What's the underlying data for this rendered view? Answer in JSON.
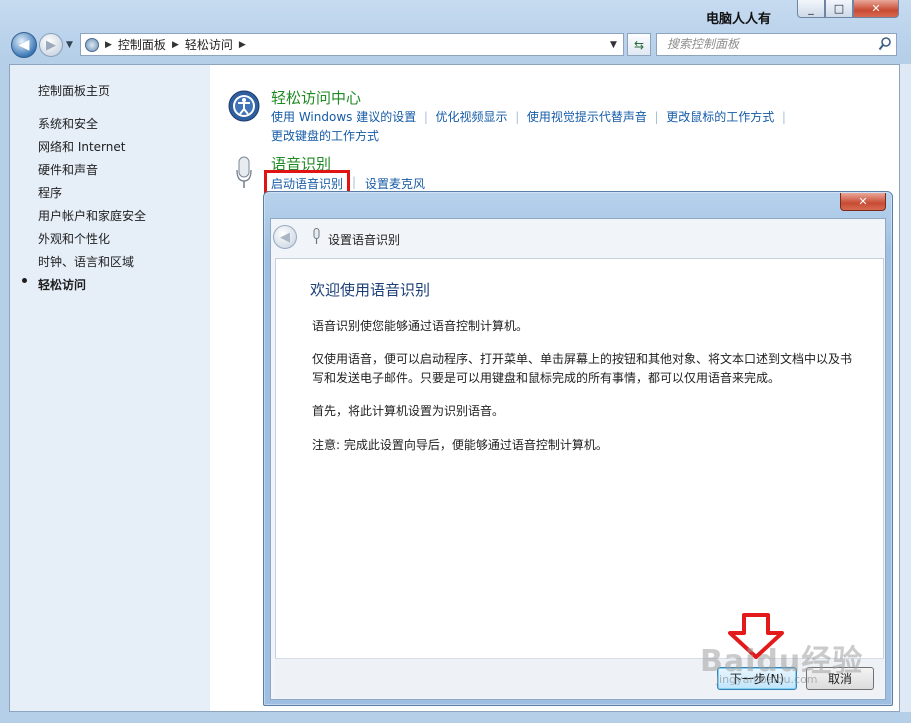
{
  "window": {
    "watermark": "电脑人人有",
    "close_glyph": "✕",
    "min_glyph": "_",
    "max_glyph": "□"
  },
  "nav": {
    "breadcrumb": [
      "控制面板",
      "轻松访问"
    ],
    "search_placeholder": "搜索控制面板"
  },
  "sidebar": {
    "items": [
      "控制面板主页",
      "系统和安全",
      "网络和 Internet",
      "硬件和声音",
      "程序",
      "用户帐户和家庭安全",
      "外观和个性化",
      "时钟、语言和区域",
      "轻松访问"
    ],
    "active": "轻松访问"
  },
  "main": {
    "ease_center": {
      "title": "轻松访问中心",
      "links": [
        "使用 Windows 建议的设置",
        "优化视频显示",
        "使用视觉提示代替声音",
        "更改鼠标的工作方式",
        "更改键盘的工作方式"
      ]
    },
    "speech": {
      "title": "语音识别",
      "links": [
        "启动语音识别",
        "设置麦克风"
      ]
    }
  },
  "wizard": {
    "title": "设置语音识别",
    "heading": "欢迎使用语音识别",
    "paragraphs": [
      "语音识别使您能够通过语音控制计算机。",
      "仅使用语音，便可以启动程序、打开菜单、单击屏幕上的按钮和其他对象、将文本口述到文档中以及书写和发送电子邮件。只要是可以用键盘和鼠标完成的所有事情，都可以仅用语音来完成。",
      "首先，将此计算机设置为识别语音。",
      "注意: 完成此设置向导后，便能够通过语音控制计算机。"
    ],
    "next_label": "下一步(N)",
    "cancel_label": "取消"
  },
  "overlay": {
    "watermark_brand": "Baidu经验",
    "watermark_url": "jingyan.baidu.com"
  }
}
